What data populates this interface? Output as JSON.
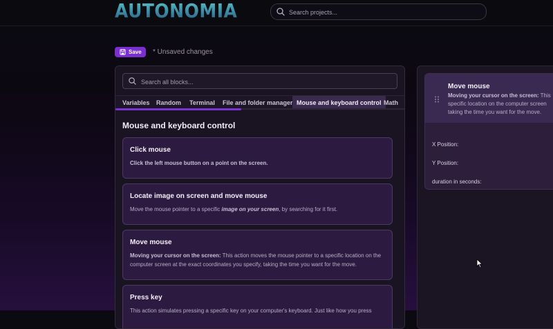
{
  "header": {
    "logo_text": "AUTONOMIA",
    "search_placeholder": "Search projects...",
    "icons": [
      "search-icon"
    ]
  },
  "toolbar": {
    "save_label": "Save",
    "status_text": "* Unsaved changes",
    "accent_color": "#7b2fd0"
  },
  "blocks_panel": {
    "search_placeholder": "Search all blocks...",
    "tabs": [
      {
        "label": "Variables",
        "active": false
      },
      {
        "label": "Random",
        "active": false
      },
      {
        "label": "Terminal",
        "active": false
      },
      {
        "label": "File and folder manager",
        "active": false
      },
      {
        "label": "Mouse and keyboard control",
        "active": true
      },
      {
        "label": "Math",
        "active": false
      }
    ],
    "section_title": "Mouse and keyboard control",
    "cards": [
      {
        "title": "Click mouse",
        "description_bold": "Click the left mouse button on a point on the screen.",
        "description": ""
      },
      {
        "title": "Locate image on screen and move mouse",
        "description_pre": "Move the mouse pointer to a specific ",
        "description_em": "image on your screen",
        "description_post": ", by searching for it first."
      },
      {
        "title": "Move mouse",
        "description_bold": "Moving your cursor on the screen:",
        "description": " This action moves the mouse pointer to a specific location on the computer screen at the exact coordinates you specify, taking the time you want for the move."
      },
      {
        "title": "Press key",
        "description": "This action simulates pressing a specific key on your computer's keyboard. Just like how you press"
      }
    ]
  },
  "workspace": {
    "block": {
      "title": "Move mouse",
      "description_bold": "Moving your cursor on the screen:",
      "description_line1_rest": " This",
      "description_line2": "specific location on the computer screen",
      "description_line3": "taking the time you want for the move.",
      "fields": [
        "X Position:",
        "Y Position:",
        "duration in seconds:"
      ]
    }
  }
}
